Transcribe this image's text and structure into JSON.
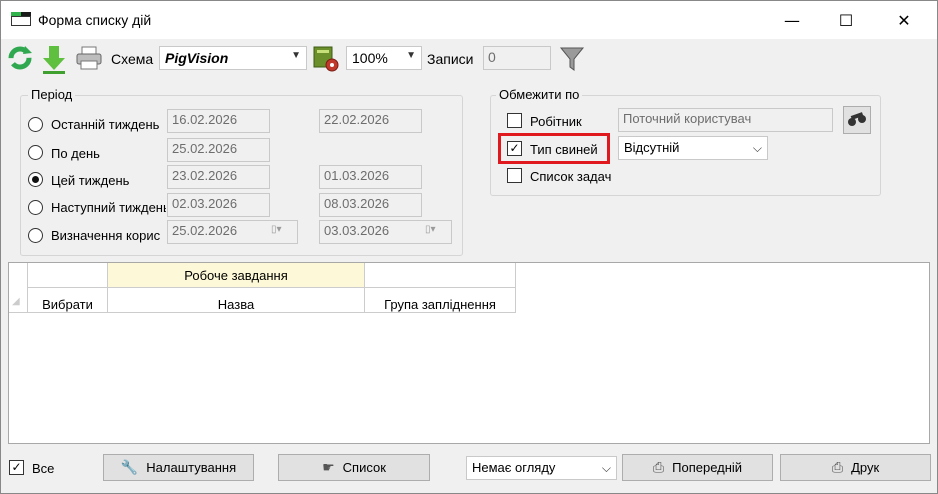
{
  "window": {
    "title": "Форма списку дій",
    "minimize_glyph": "—",
    "maximize_glyph": "☐",
    "close_glyph": "✕"
  },
  "toolbar": {
    "scheme_label": "Схема",
    "scheme_value": "PigVision",
    "zoom_value": "100%",
    "records_label": "Записи",
    "records_value": "0"
  },
  "period": {
    "title": "Період",
    "options": [
      {
        "label": "Останній тиждень",
        "from": "16.02.2026",
        "to": "22.02.2026",
        "selected": false
      },
      {
        "label": "По день",
        "from": "25.02.2026",
        "to": "",
        "selected": false
      },
      {
        "label": "Цей тиждень",
        "from": "23.02.2026",
        "to": "01.03.2026",
        "selected": true
      },
      {
        "label": "Наступний тиждень",
        "from": "02.03.2026",
        "to": "08.03.2026",
        "selected": false
      },
      {
        "label": "Визначення корис",
        "from": "25.02.2026",
        "to": "03.03.2026",
        "selected": false
      }
    ]
  },
  "restrict": {
    "title": "Обмежити по",
    "worker_label": "Робітник",
    "worker_value": "Поточний користувач",
    "pig_type_label": "Тип свиней",
    "pig_type_value": "Відсутній",
    "task_list_label": "Список задач",
    "check_glyph": "✓"
  },
  "grid": {
    "group_header": "Робоче завдання",
    "columns": [
      "Вибрати",
      "Назва",
      "Група запліднення"
    ]
  },
  "footer": {
    "all_label": "Все",
    "settings_button": "Налаштування",
    "list_button": "Список",
    "view_select": "Немає огляду",
    "previous_button": "Попередній",
    "print_button": "Друк"
  },
  "colors": {
    "highlight": "#e0191e",
    "group_header_bg": "#fdf9d8",
    "refresh_green": "#2fa84f"
  }
}
